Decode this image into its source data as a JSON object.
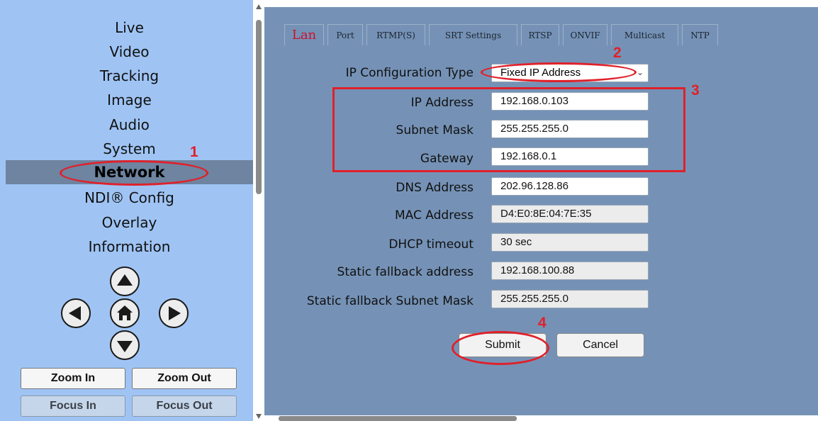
{
  "sidebar": {
    "nav_items": [
      {
        "label": "Live"
      },
      {
        "label": "Video"
      },
      {
        "label": "Tracking"
      },
      {
        "label": "Image"
      },
      {
        "label": "Audio"
      },
      {
        "label": "System"
      },
      {
        "label": "Network",
        "active": true
      },
      {
        "label": "NDI® Config"
      },
      {
        "label": "Overlay"
      },
      {
        "label": "Information"
      }
    ],
    "ptz_icons": {
      "up": "arrow-up-icon",
      "left": "arrow-left-icon",
      "home": "home-icon",
      "right": "arrow-right-icon",
      "down": "arrow-down-icon"
    },
    "zoom_in_label": "Zoom In",
    "zoom_out_label": "Zoom Out",
    "focus_in_label": "Focus In",
    "focus_out_label": "Focus Out"
  },
  "tabs": [
    {
      "label": "Lan",
      "active": true
    },
    {
      "label": "Port"
    },
    {
      "label": "RTMP(S)"
    },
    {
      "label": "SRT Settings"
    },
    {
      "label": "RTSP"
    },
    {
      "label": "ONVIF"
    },
    {
      "label": "Multicast"
    },
    {
      "label": "NTP"
    }
  ],
  "form": {
    "ip_config_type": {
      "label": "IP Configuration Type",
      "value": "Fixed IP Address"
    },
    "ip_address": {
      "label": "IP Address",
      "value": "192.168.0.103"
    },
    "subnet_mask": {
      "label": "Subnet Mask",
      "value": "255.255.255.0"
    },
    "gateway": {
      "label": "Gateway",
      "value": "192.168.0.1"
    },
    "dns_address": {
      "label": "DNS Address",
      "value": "202.96.128.86"
    },
    "mac_address": {
      "label": "MAC Address",
      "value": "D4:E0:8E:04:7E:35"
    },
    "dhcp_timeout": {
      "label": "DHCP timeout",
      "value": "30 sec"
    },
    "static_fallback_address": {
      "label": "Static fallback address",
      "value": "192.168.100.88"
    },
    "static_fallback_subnet": {
      "label": "Static fallback Subnet Mask",
      "value": "255.255.255.0"
    }
  },
  "actions": {
    "submit_label": "Submit",
    "cancel_label": "Cancel"
  },
  "annotations": {
    "markers": [
      "1",
      "2",
      "3",
      "4"
    ],
    "color": "#e0202a"
  },
  "colors": {
    "sidebar_bg": "#9fc4f4",
    "main_bg": "#7592b6",
    "active_nav_bg": "#6e84a0",
    "active_tab_text": "#c8102e"
  }
}
